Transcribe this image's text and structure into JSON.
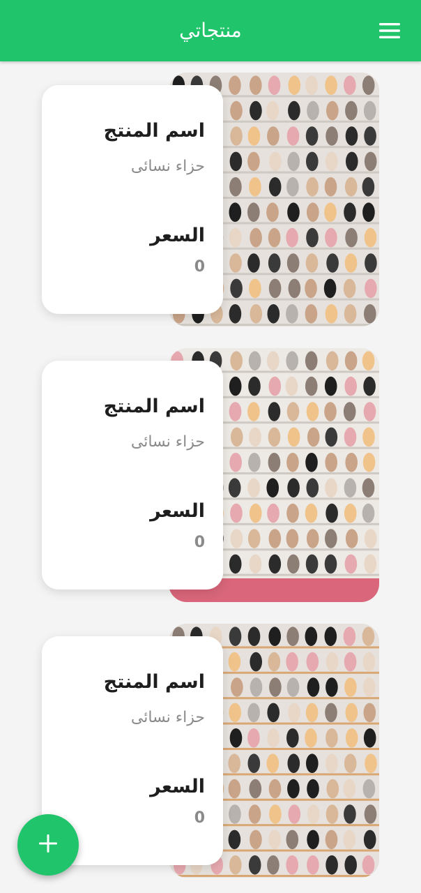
{
  "app": {
    "title": "منتجاتي",
    "menu_icon": "hamburger-menu-icon",
    "accent_color": "#20c46a"
  },
  "products": [
    {
      "name_label": "اسم المنتج",
      "name_value": "حزاء نسائى",
      "price_label": "السعر",
      "price_value": "0",
      "image": "shoe-rack-photo"
    },
    {
      "name_label": "اسم المنتج",
      "name_value": "حزاء نسائى",
      "price_label": "السعر",
      "price_value": "0",
      "image": "shoe-rack-photo"
    },
    {
      "name_label": "اسم المنتج",
      "name_value": "حزاء نسائى",
      "price_label": "السعر",
      "price_value": "0",
      "image": "shoe-rack-photo"
    }
  ],
  "fab": {
    "icon": "plus-icon"
  }
}
